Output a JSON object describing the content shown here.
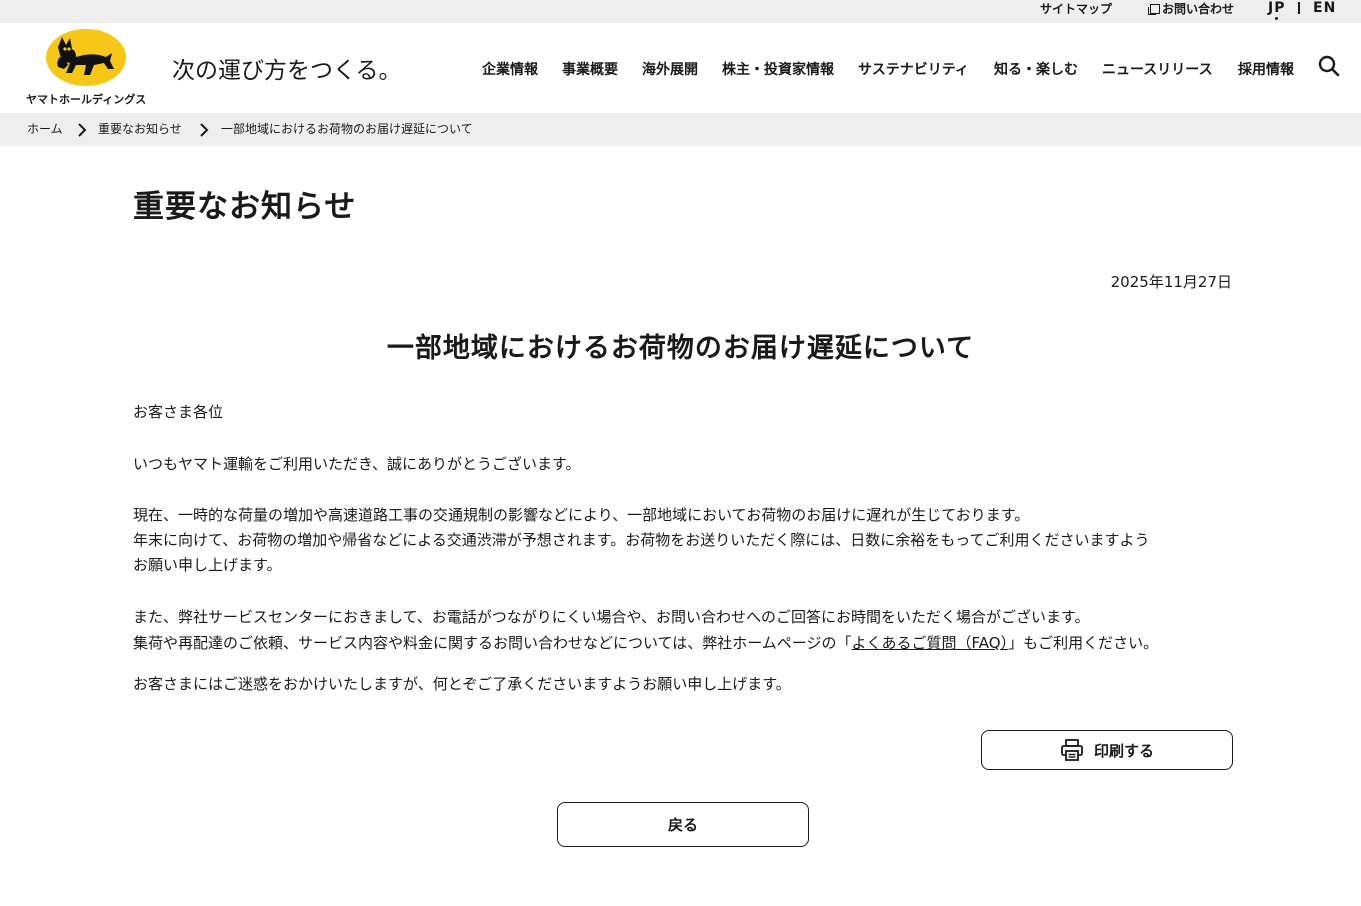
{
  "utility": {
    "sitemap": "サイトマップ",
    "contact": "お問い合わせ",
    "lang_jp": "JP",
    "lang_en": "EN"
  },
  "header": {
    "logo_text": "ヤマトホールディングス",
    "tagline": "次の運び方をつくる。",
    "nav": [
      "企業情報",
      "事業概要",
      "海外展開",
      "株主・投資家情報",
      "サステナビリティ",
      "知る・楽しむ",
      "ニュースリリース",
      "採用情報"
    ]
  },
  "breadcrumb": [
    "ホーム",
    "重要なお知らせ",
    "一部地域におけるお荷物のお届け遅延について"
  ],
  "main": {
    "page_title": "重要なお知らせ",
    "date": "2025年11月27日",
    "article_title": "一部地域におけるお荷物のお届け遅延について",
    "greeting": "お客さま各位",
    "thanks": "いつもヤマト運輸をご利用いただき、誠にありがとうございます。",
    "p1_line1": "現在、一時的な荷量の増加や高速道路工事の交通規制の影響などにより、一部地域においてお荷物のお届けに遅れが生じております。",
    "p1_line2": "年末に向けて、お荷物の増加や帰省などによる交通渋滞が予想されます。お荷物をお送りいただく際には、日数に余裕をもってご利用くださいますよう",
    "p1_line3": "お願い申し上げます。",
    "p2_line1": "また、弊社サービスセンターにおきまして、お電話がつながりにくい場合や、お問い合わせへのご回答にお時間をいただく場合がございます。",
    "p2_line2_before": "集荷や再配達のご依頼、サービス内容や料金に関するお問い合わせなどについては、弊社ホームページの「",
    "p2_link": "よくあるご質問（FAQ）",
    "p2_line2_after": "」もご利用ください。",
    "closing": "お客さまにはご迷惑をおかけいたしますが、何とぞご了承くださいますようお願い申し上げます。",
    "print_label": "印刷する",
    "back_label": "戻る"
  },
  "colors": {
    "brand_yellow": "#f6c717",
    "bar_gray": "#eeeeee",
    "text": "#1a1a1a"
  },
  "icons": [
    "external-window-icon",
    "search-icon",
    "chevron-right-icon",
    "printer-icon",
    "black-cat-logo-icon"
  ]
}
